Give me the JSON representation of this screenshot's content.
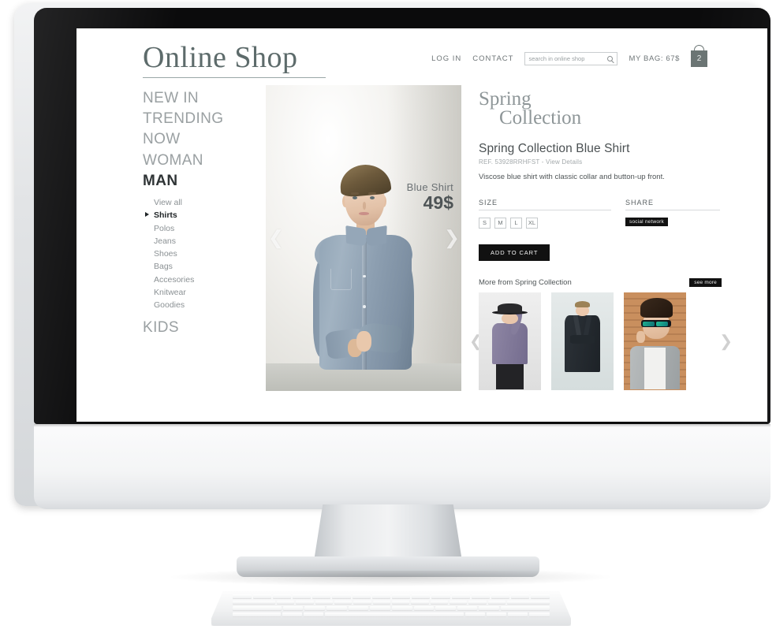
{
  "site": {
    "logo": "Online Shop"
  },
  "header": {
    "login_label": "LOG IN",
    "contact_label": "CONTACT",
    "search_placeholder": "search in online shop",
    "search_value": "",
    "search_icon": "search-icon",
    "bag_label": "MY BAG: 67$",
    "bag_count": "2"
  },
  "sidebar": {
    "categories": [
      {
        "label": "NEW IN",
        "active": false
      },
      {
        "label": "TRENDING NOW",
        "active": false
      },
      {
        "label": "WOMAN",
        "active": false
      },
      {
        "label": "MAN",
        "active": true
      },
      {
        "label": "KIDS",
        "active": false
      }
    ],
    "subitems": [
      {
        "label": "View all",
        "active": false
      },
      {
        "label": "Shirts",
        "active": true
      },
      {
        "label": "Polos",
        "active": false
      },
      {
        "label": "Jeans",
        "active": false
      },
      {
        "label": "Shoes",
        "active": false
      },
      {
        "label": "Bags",
        "active": false
      },
      {
        "label": "Accesories",
        "active": false
      },
      {
        "label": "Knitwear",
        "active": false
      },
      {
        "label": "Goodies",
        "active": false
      }
    ]
  },
  "hero": {
    "product_name": "Blue Shirt",
    "price": "49$",
    "prev_arrow": "❮",
    "next_arrow": "❯"
  },
  "detail": {
    "collection_line1": "Spring",
    "collection_line2": "Collection",
    "product_title": "Spring Collection Blue Shirt",
    "product_ref": "REF. 53928RRHFST - View Details",
    "product_description": "Viscose blue shirt with classic collar and button-up front.",
    "size_heading": "SIZE",
    "sizes": [
      "S",
      "M",
      "L",
      "XL"
    ],
    "share_heading": "SHARE",
    "share_badge": "social network",
    "add_to_cart": "ADD TO CART"
  },
  "more": {
    "title": "More from Spring Collection",
    "see_more": "see more",
    "prev_arrow": "❮",
    "next_arrow": "❯",
    "thumbs": [
      {
        "alt": "man-with-hat-purple-shirt"
      },
      {
        "alt": "man-in-dark-blazer"
      },
      {
        "alt": "man-with-sunglasses-brick-wall"
      }
    ]
  },
  "colors": {
    "logo": "#5d6b6b",
    "accent_dark": "#111111",
    "muted_text": "#9aa0a2",
    "active_text": "#2f3436"
  }
}
